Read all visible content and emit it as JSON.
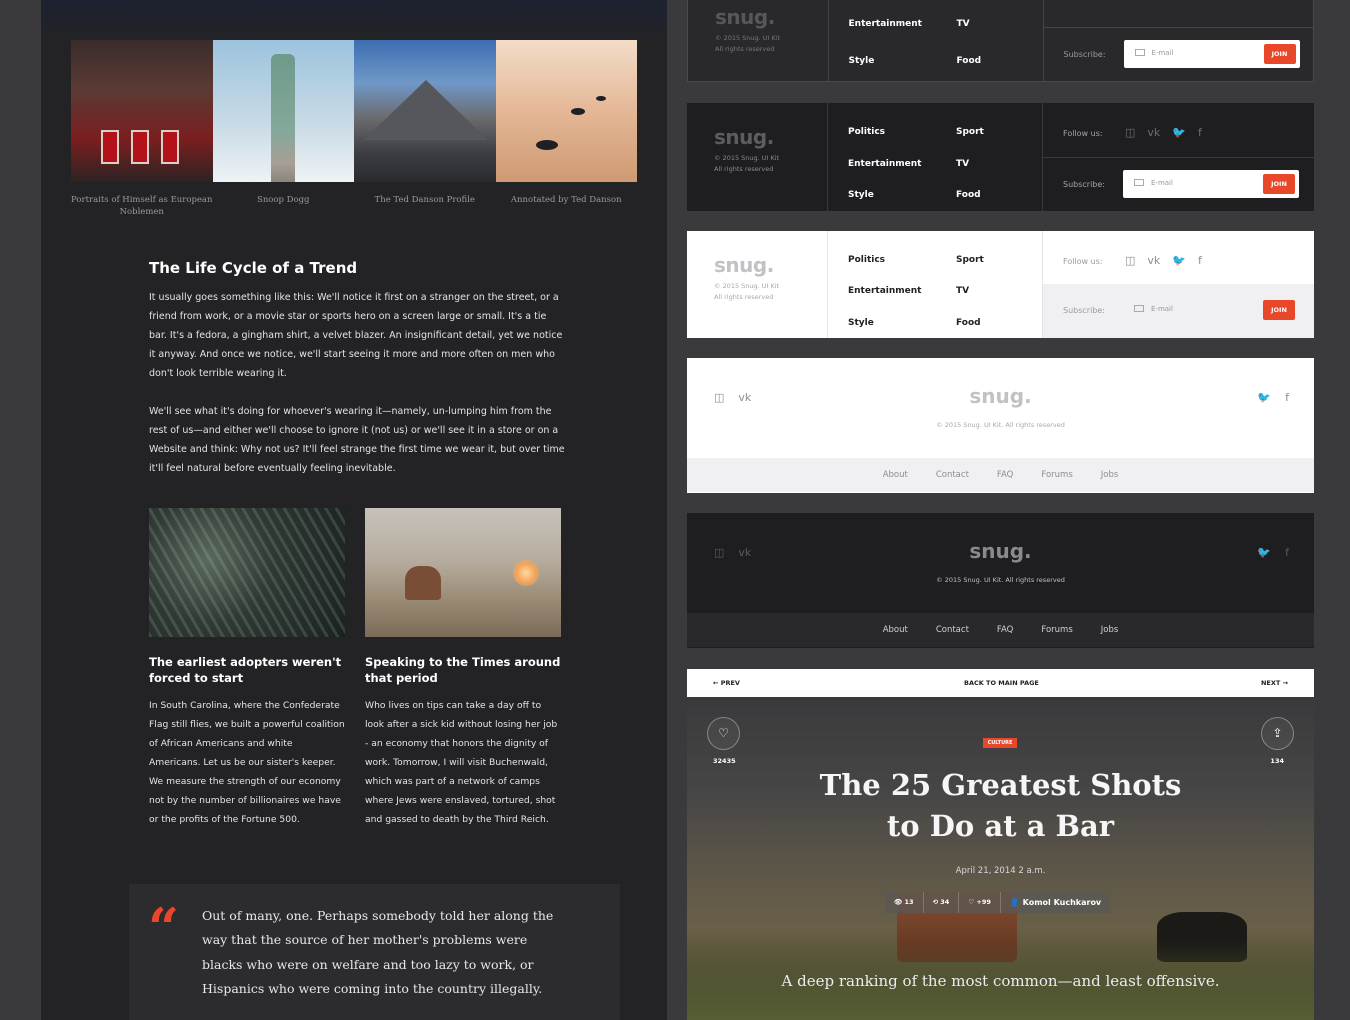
{
  "gallery": {
    "captions": [
      "Portraits of Himself as European Noblemen",
      "Snoop Dogg",
      "The Ted Danson Profile",
      "Annotated by Ted Danson"
    ]
  },
  "article": {
    "title": "The Life Cycle of a Trend",
    "paragraph_1": "It usually goes something like this: We'll notice it first on a stranger on the street, or a friend from work, or a movie star or sports hero on a screen large or small. It's a tie bar. It's a fedora, a gingham shirt, a velvet blazer. An insignificant detail, yet we notice it anyway. And once we notice, we'll start seeing it more and more often on men who don't look terrible wearing it.",
    "paragraph_2": "We'll see what it's doing for whoever's wearing it—namely, un-lumping him from the rest of us—and either we'll choose to ignore it (not us) or we'll see it in a store or on a Website and think: Why not us? It'll feel strange the first time we wear it, but over time it'll feel natural before eventually feeling inevitable.",
    "col_1": {
      "heading": "The earliest adopters weren't forced to start",
      "body": "In South Carolina, where the Confederate Flag still flies, we built a powerful coalition of African Americans and white Americans. Let us be our sister's keeper. We measure the strength of our economy not by the number of billionaires we have or the profits of the Fortune 500."
    },
    "col_2": {
      "heading": "Speaking to the Times around that period",
      "body": "Who lives on tips can take a day off to look after a sick kid without losing her job - an economy that honors the dignity of work. Tomorrow, I will visit Buchenwald, which was part of a network of camps where Jews were enslaved, tortured, shot and gassed to death by the Third Reich."
    },
    "quote_mark": "“",
    "quote": "Out of many, one. Perhaps somebody told her along the way that the source of her mother's problems were blacks who were on welfare and too lazy to work, or Hispanics who were coming into the country illegally."
  },
  "footer_a": {
    "logo": "snug.",
    "copyright_line_1": "© 2015 Snug. UI Kit",
    "copyright_line_2": "All rights reserved",
    "links": [
      "Politics",
      "Sport",
      "Entertainment",
      "TV",
      "Style",
      "Food"
    ],
    "follow_label": "Follow us:",
    "social_icons": [
      "instagram-icon",
      "vk-icon",
      "twitter-icon",
      "facebook-icon"
    ],
    "social_glyphs": [
      "◫",
      "vk",
      "🐦",
      "f"
    ],
    "subscribe_label": "Subscribe:",
    "email_placeholder": "E-mail",
    "join_label": "JOIN"
  },
  "footer_b": {
    "logo": "snug.",
    "copyright": "© 2015 Snug. UI Kit. All rights reserved",
    "left_glyphs": [
      "◫",
      "vk"
    ],
    "right_glyphs": [
      "🐦",
      "f"
    ],
    "nav": [
      "About",
      "Contact",
      "FAQ",
      "Forums",
      "Jobs"
    ]
  },
  "hero": {
    "prev_label": "← PREV",
    "back_label": "BACK TO MAIN PAGE",
    "next_label": "NEXT →",
    "like_glyph": "♡",
    "share_glyph": "⇪",
    "like_count": "32435",
    "share_count": "134",
    "tag": "CULTURE",
    "title_line_1": "The 25 Greatest Shots",
    "title_line_2": "to Do at a Bar",
    "date": "April 21, 2014 2 a.m.",
    "stats": {
      "views": "👁 13",
      "comments": "⟲ 34",
      "likes": "♡ +99",
      "author": "👤 Komol Kuchkarov"
    },
    "deck": "A deep ranking of the most common—and least offensive."
  },
  "colors": {
    "accent": "#e8472a",
    "dark_panel": "#232326",
    "background": "#3a3a3c"
  }
}
